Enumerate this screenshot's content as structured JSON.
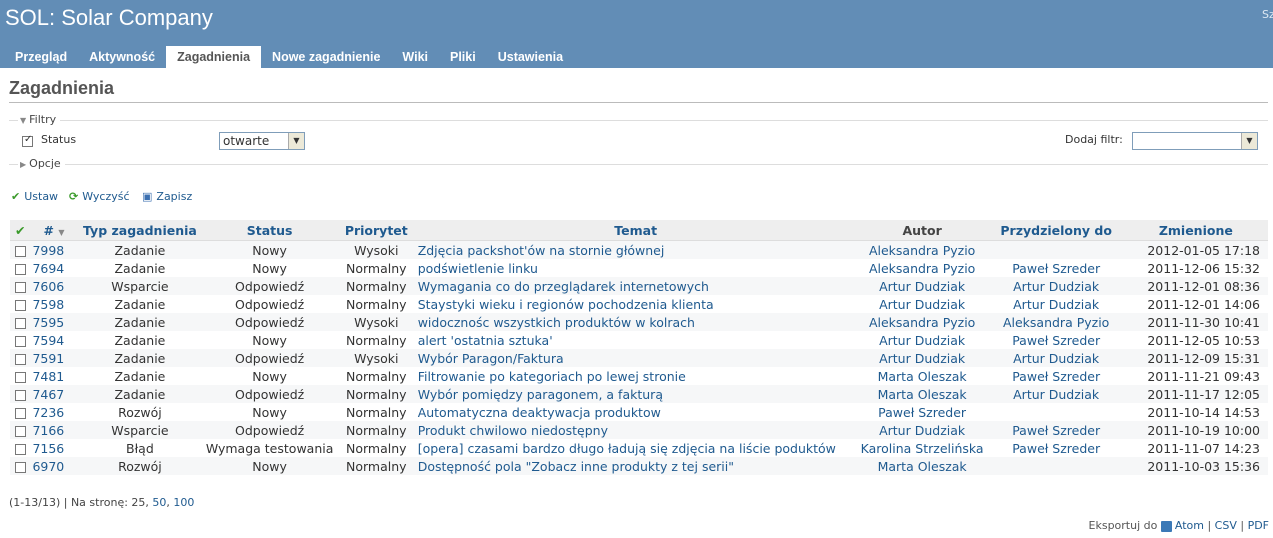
{
  "app": {
    "title": "SOL: Solar Company",
    "search_hint": "Sz"
  },
  "tabs": [
    {
      "label": "Przegląd"
    },
    {
      "label": "Aktywność"
    },
    {
      "label": "Zagadnienia",
      "active": true
    },
    {
      "label": "Nowe zagadnienie"
    },
    {
      "label": "Wiki"
    },
    {
      "label": "Pliki"
    },
    {
      "label": "Ustawienia"
    }
  ],
  "page_title": "Zagadnienia",
  "filters": {
    "legend": "Filtry",
    "status_label": "Status",
    "status_value": "otwarte",
    "add_filter_label": "Dodaj filtr:",
    "add_filter_value": ""
  },
  "options": {
    "legend": "Opcje"
  },
  "actions": {
    "apply": "Ustaw",
    "clear": "Wyczyść",
    "save": "Zapisz"
  },
  "columns": [
    "#",
    "Typ zagadnienia",
    "Status",
    "Priorytet",
    "Temat",
    "Autor",
    "Przydzielony do",
    "Zmienione"
  ],
  "issues": [
    {
      "id": "7998",
      "type": "Zadanie",
      "status": "Nowy",
      "priority": "Wysoki",
      "subject": "Zdjęcia packshot'ów na stornie głównej",
      "author": "Aleksandra Pyzio",
      "assignee": "",
      "updated": "2012-01-05 17:18"
    },
    {
      "id": "7694",
      "type": "Zadanie",
      "status": "Nowy",
      "priority": "Normalny",
      "subject": "podświetlenie linku",
      "author": "Aleksandra Pyzio",
      "assignee": "Paweł Szreder",
      "updated": "2011-12-06 15:32"
    },
    {
      "id": "7606",
      "type": "Wsparcie",
      "status": "Odpowiedź",
      "priority": "Normalny",
      "subject": "Wymagania co do przeglądarek internetowych",
      "author": "Artur Dudziak",
      "assignee": "Artur Dudziak",
      "updated": "2011-12-01 08:36"
    },
    {
      "id": "7598",
      "type": "Zadanie",
      "status": "Odpowiedź",
      "priority": "Normalny",
      "subject": "Staystyki wieku i regionów pochodzenia klienta",
      "author": "Artur Dudziak",
      "assignee": "Artur Dudziak",
      "updated": "2011-12-01 14:06"
    },
    {
      "id": "7595",
      "type": "Zadanie",
      "status": "Odpowiedź",
      "priority": "Wysoki",
      "subject": "widocznośc wszystkich produktów w kolrach",
      "author": "Aleksandra Pyzio",
      "assignee": "Aleksandra Pyzio",
      "updated": "2011-11-30 10:41"
    },
    {
      "id": "7594",
      "type": "Zadanie",
      "status": "Nowy",
      "priority": "Normalny",
      "subject": "alert 'ostatnia sztuka'",
      "author": "Artur Dudziak",
      "assignee": "Paweł Szreder",
      "updated": "2011-12-05 10:53"
    },
    {
      "id": "7591",
      "type": "Zadanie",
      "status": "Odpowiedź",
      "priority": "Wysoki",
      "subject": "Wybór Paragon/Faktura",
      "author": "Artur Dudziak",
      "assignee": "Artur Dudziak",
      "updated": "2011-12-09 15:31"
    },
    {
      "id": "7481",
      "type": "Zadanie",
      "status": "Nowy",
      "priority": "Normalny",
      "subject": "Filtrowanie po kategoriach po lewej stronie",
      "author": "Marta Oleszak",
      "assignee": "Paweł Szreder",
      "updated": "2011-11-21 09:43"
    },
    {
      "id": "7467",
      "type": "Zadanie",
      "status": "Odpowiedź",
      "priority": "Normalny",
      "subject": "Wybór pomiędzy paragonem, a fakturą",
      "author": "Marta Oleszak",
      "assignee": "Artur Dudziak",
      "updated": "2011-11-17 12:05"
    },
    {
      "id": "7236",
      "type": "Rozwój",
      "status": "Nowy",
      "priority": "Normalny",
      "subject": "Automatyczna deaktywacja produktow",
      "author": "Paweł Szreder",
      "assignee": "",
      "updated": "2011-10-14 14:53"
    },
    {
      "id": "7166",
      "type": "Wsparcie",
      "status": "Odpowiedź",
      "priority": "Normalny",
      "subject": "Produkt chwilowo niedostępny",
      "author": "Artur Dudziak",
      "assignee": "Paweł Szreder",
      "updated": "2011-10-19 10:00"
    },
    {
      "id": "7156",
      "type": "Błąd",
      "status": "Wymaga testowania",
      "priority": "Normalny",
      "subject": "[opera] czasami bardzo długo ładują się zdjęcia na liście poduktów",
      "author": "Karolina Strzelińska",
      "assignee": "Paweł Szreder",
      "updated": "2011-11-07 14:23"
    },
    {
      "id": "6970",
      "type": "Rozwój",
      "status": "Nowy",
      "priority": "Normalny",
      "subject": "Dostępność pola \"Zobacz inne produkty z tej serii\"",
      "author": "Marta Oleszak",
      "assignee": "",
      "updated": "2011-10-03 15:36"
    }
  ],
  "pagination": {
    "summary": "(1-13/13) | Na stronę: 25,",
    "opt1": "50",
    "opt2": "100"
  },
  "export": {
    "label": "Eksportuj do",
    "atom": "Atom",
    "csv": "CSV",
    "pdf": "PDF"
  }
}
